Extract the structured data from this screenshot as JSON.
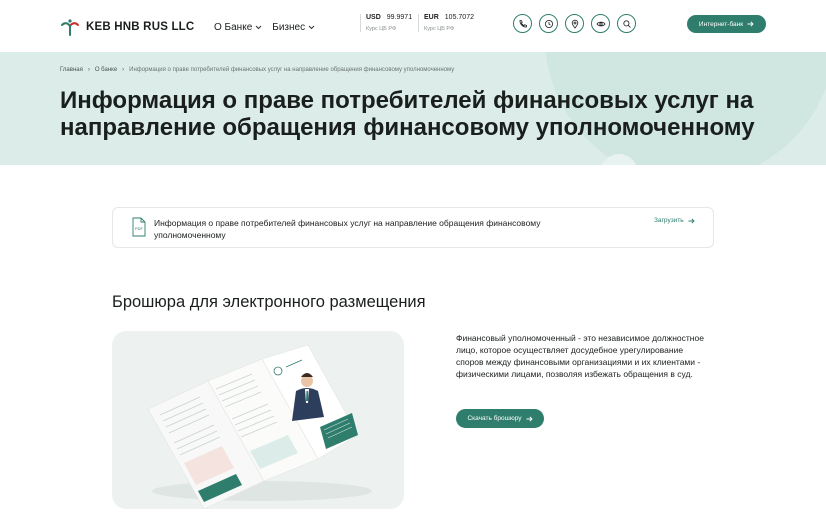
{
  "header": {
    "logo_text": "KEB HNB RUS LLC",
    "nav": [
      {
        "label": "О Банке"
      },
      {
        "label": "Бизнес"
      }
    ],
    "rates": [
      {
        "code": "USD",
        "value": "99.9971",
        "sub": "Курс ЦБ РФ"
      },
      {
        "code": "EUR",
        "value": "105.7072",
        "sub": "Курс ЦБ РФ"
      }
    ],
    "icons": [
      "phone-icon",
      "clock-icon",
      "location-icon",
      "eye-icon",
      "search-icon"
    ],
    "internet_bank_label": "Интернет-банк"
  },
  "hero": {
    "breadcrumb": [
      "Главная",
      "О банке",
      "Информация о праве потребителей финансовых услуг на направление обращения финансовому уполномоченному"
    ],
    "title": "Информация о праве потребителей финансовых услуг на направление обращения финансовому уполномоченному"
  },
  "document": {
    "badge": "PDF",
    "title": "Информация о праве потребителей финансовых услуг на направление обращения финансовому уполномоченному",
    "download_label": "Загрузить"
  },
  "brochure": {
    "section_title": "Брошюра для электронного размещения",
    "description": "Финансовый уполномоченный - это независимое должностное лицо, которое осуществляет досудебное урегулирование споров между финансовыми организациями и их клиентами - физическими лицами, позволяя избежать обращения в суд.",
    "button_label": "Скачать брошюру"
  },
  "colors": {
    "accent": "#2f7d6d",
    "hero_bg": "#dcede9"
  }
}
